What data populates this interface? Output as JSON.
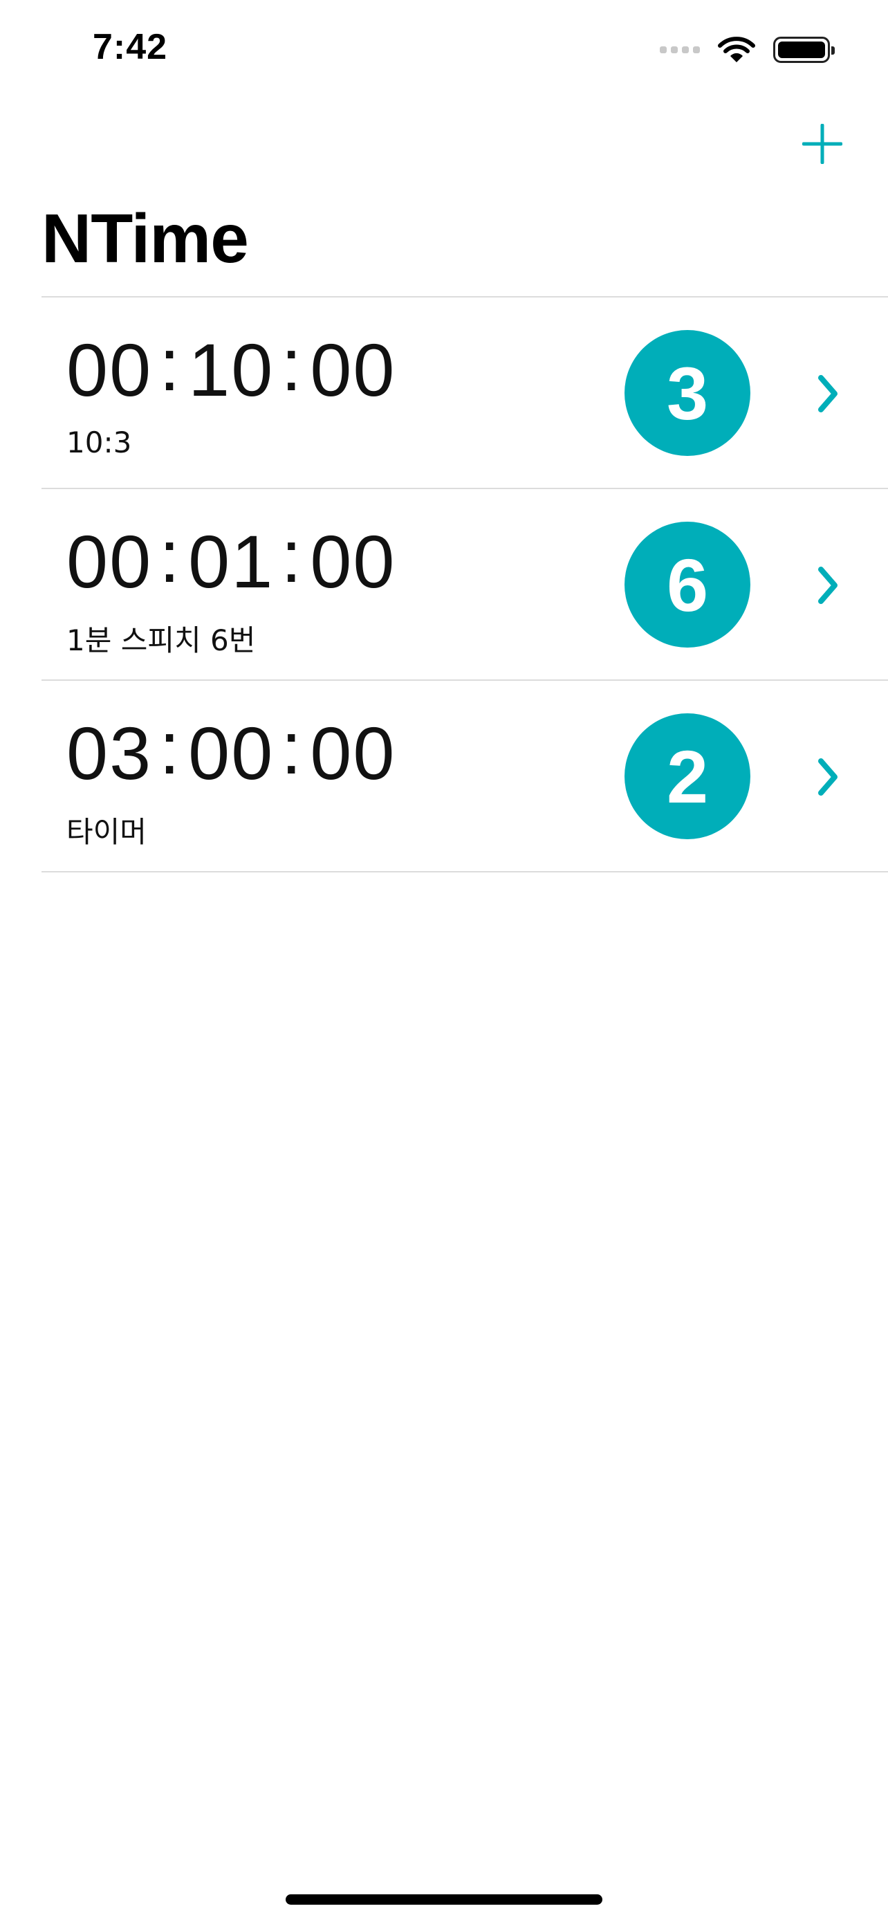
{
  "status_bar": {
    "time": "7:42"
  },
  "nav": {
    "title": "NTime",
    "add_icon": "plus-icon"
  },
  "accent_color": "#00aeb9",
  "timers": [
    {
      "hours": "00",
      "minutes": "10",
      "seconds": "00",
      "label": "10:3",
      "count": "3"
    },
    {
      "hours": "00",
      "minutes": "01",
      "seconds": "00",
      "label": "1분 스피치 6번",
      "count": "6"
    },
    {
      "hours": "03",
      "minutes": "00",
      "seconds": "00",
      "label": "타이머",
      "count": "2"
    }
  ]
}
